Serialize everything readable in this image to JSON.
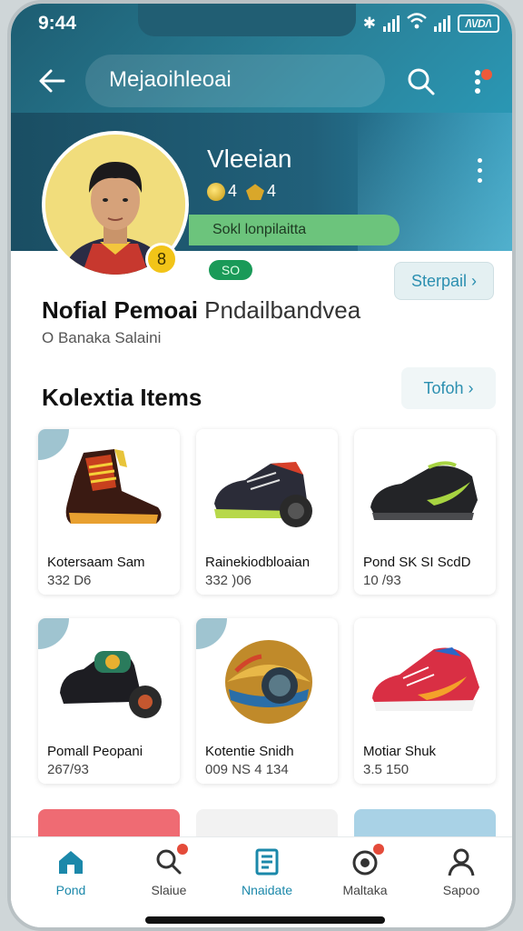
{
  "status": {
    "time": "9:44",
    "battery_label": "/\\\\/D/\\"
  },
  "topbar": {
    "title": "Mejaoihleoai"
  },
  "profile": {
    "name": "Vleeian",
    "coins": "4",
    "gems": "4",
    "status_bar_text": "Sokl lonpilaitta",
    "level": "8",
    "chip": "SO",
    "search_chip": "Sterpail",
    "full_name_bold": "Nofial Pemoai",
    "full_name_light": "Pndailbandvea",
    "location": "O Banaka Salaini"
  },
  "section": {
    "title": "Kolextia Items",
    "see_all": "Tofoh"
  },
  "items": [
    {
      "name": "Kotersaam Sam",
      "meta": "332 D6"
    },
    {
      "name": "Rainekiodbloaian",
      "meta": "332 )06"
    },
    {
      "name": "Pond SK SI ScdD",
      "meta": "10 /93"
    },
    {
      "name": "Pomall Peopani",
      "meta": "267/93"
    },
    {
      "name": "Kotentie Snidh",
      "meta": "009 NS 4 134"
    },
    {
      "name": "Motiar Shuk",
      "meta": "3.5 150"
    }
  ],
  "nav": [
    {
      "label": "Pond",
      "icon": "home-icon"
    },
    {
      "label": "Slaiue",
      "icon": "search-icon"
    },
    {
      "label": "Nnaidate",
      "icon": "collection-icon"
    },
    {
      "label": "Maltaka",
      "icon": "camera-icon"
    },
    {
      "label": "Sapoo",
      "icon": "profile-icon"
    }
  ],
  "colors": {
    "accent": "#1b88aa",
    "header": "#1d5d72",
    "green": "#6cc47c",
    "badge": "#e44b3a"
  }
}
